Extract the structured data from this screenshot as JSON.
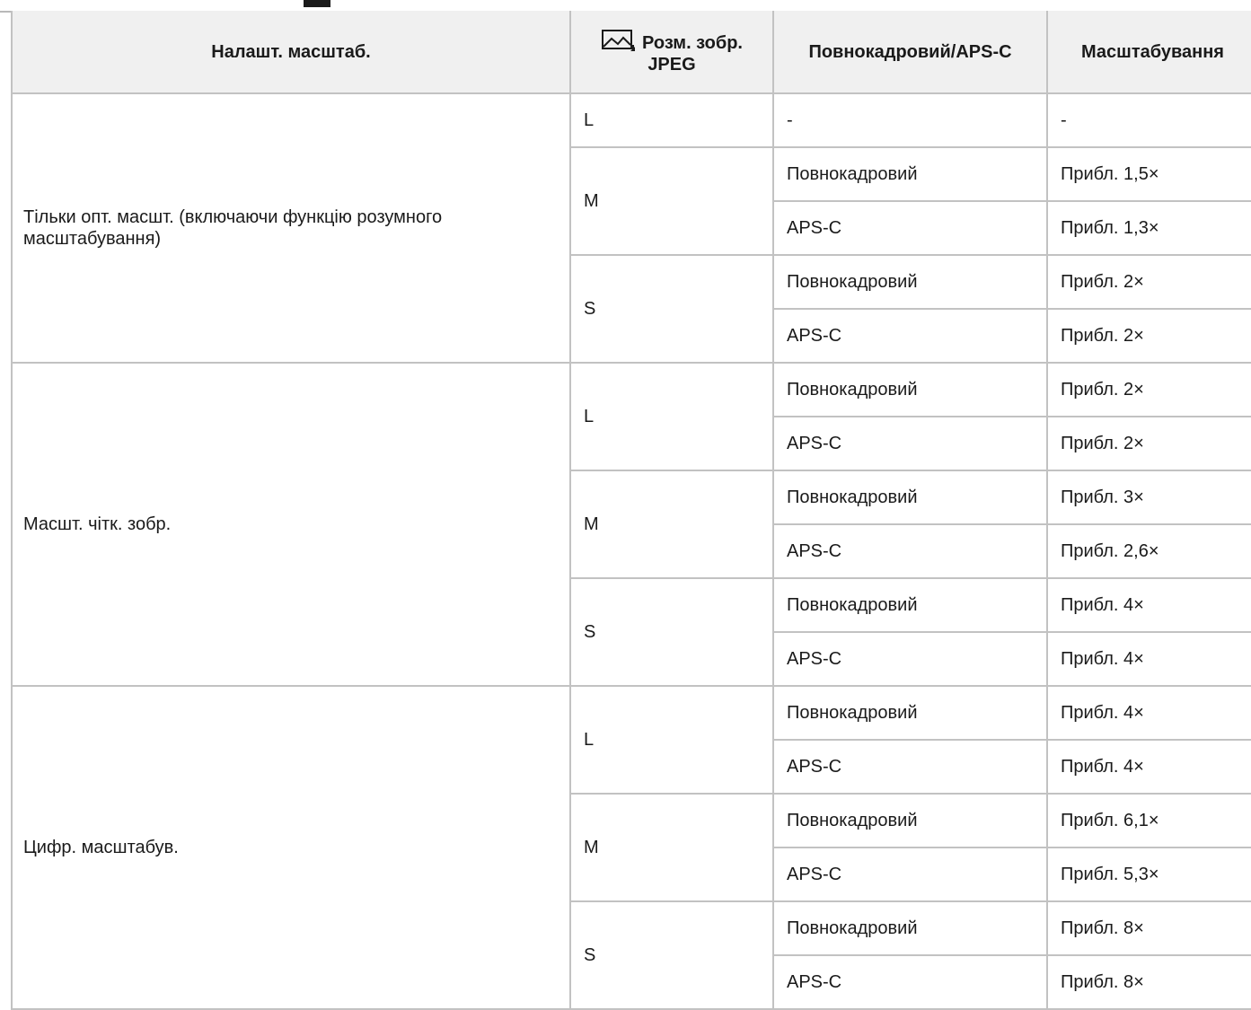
{
  "header": {
    "col_setting": "Налашт. масштаб.",
    "col_size_line1": "Розм. зобр.",
    "col_size_line2": "JPEG",
    "col_size_icon": "image-size-icon",
    "col_frame": "Повнокадровий/APS-C",
    "col_zoom": "Масштабування"
  },
  "groups": [
    {
      "setting": "Тільки опт. масшт. (включаючи функцію розумного масштабування)",
      "sizes": [
        {
          "size": "L",
          "rows": [
            {
              "frame": "-",
              "zoom": "-"
            }
          ]
        },
        {
          "size": "M",
          "rows": [
            {
              "frame": "Повнокадровий",
              "zoom": "Прибл. 1,5×"
            },
            {
              "frame": "APS-C",
              "zoom": "Прибл. 1,3×"
            }
          ]
        },
        {
          "size": "S",
          "rows": [
            {
              "frame": "Повнокадровий",
              "zoom": "Прибл. 2×"
            },
            {
              "frame": "APS-C",
              "zoom": "Прибл. 2×"
            }
          ]
        }
      ]
    },
    {
      "setting": "Масшт. чітк. зобр.",
      "sizes": [
        {
          "size": "L",
          "rows": [
            {
              "frame": "Повнокадровий",
              "zoom": "Прибл. 2×"
            },
            {
              "frame": "APS-C",
              "zoom": "Прибл. 2×"
            }
          ]
        },
        {
          "size": "M",
          "rows": [
            {
              "frame": "Повнокадровий",
              "zoom": "Прибл. 3×"
            },
            {
              "frame": "APS-C",
              "zoom": "Прибл. 2,6×"
            }
          ]
        },
        {
          "size": "S",
          "rows": [
            {
              "frame": "Повнокадровий",
              "zoom": "Прибл. 4×"
            },
            {
              "frame": "APS-C",
              "zoom": "Прибл. 4×"
            }
          ]
        }
      ]
    },
    {
      "setting": "Цифр. масштабув.",
      "sizes": [
        {
          "size": "L",
          "rows": [
            {
              "frame": "Повнокадровий",
              "zoom": "Прибл. 4×"
            },
            {
              "frame": "APS-C",
              "zoom": "Прибл. 4×"
            }
          ]
        },
        {
          "size": "M",
          "rows": [
            {
              "frame": "Повнокадровий",
              "zoom": "Прибл. 6,1×"
            },
            {
              "frame": "APS-C",
              "zoom": "Прибл. 5,3×"
            }
          ]
        },
        {
          "size": "S",
          "rows": [
            {
              "frame": "Повнокадровий",
              "zoom": "Прибл. 8×"
            },
            {
              "frame": "APS-C",
              "zoom": "Прибл. 8×"
            }
          ]
        }
      ]
    }
  ]
}
